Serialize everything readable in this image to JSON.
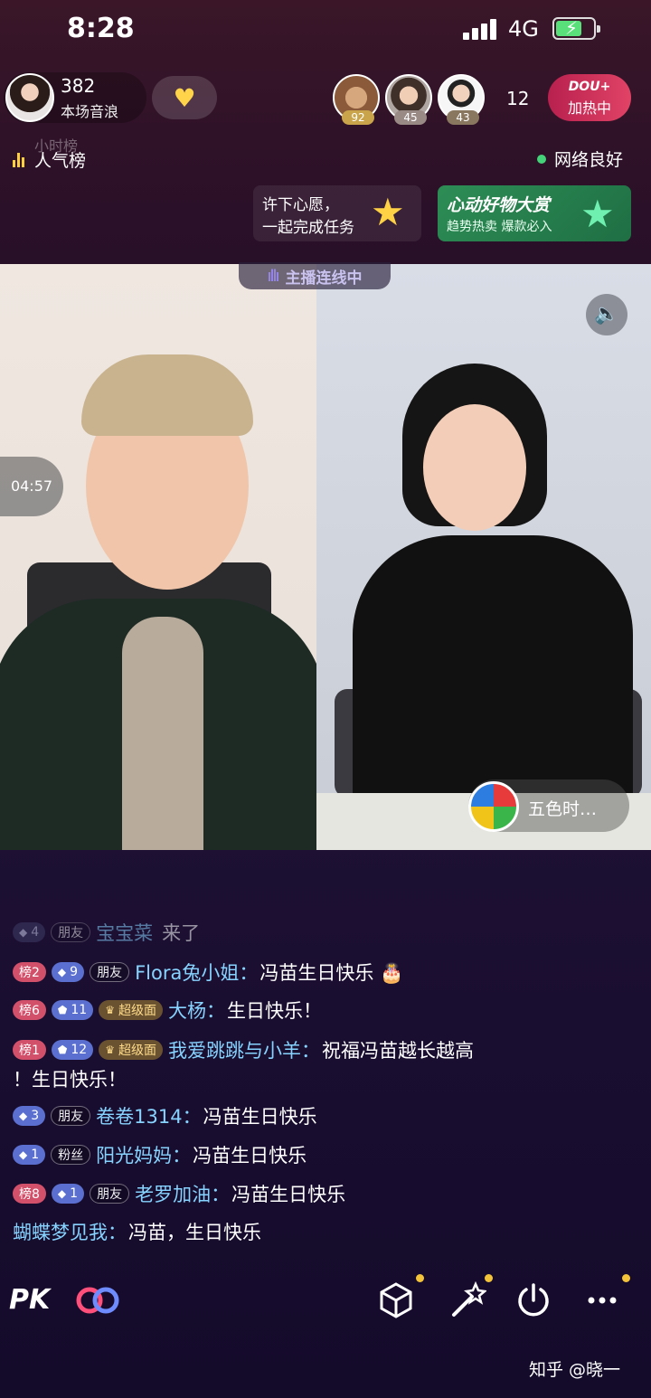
{
  "status_bar": {
    "time": "8:28",
    "network": "4G"
  },
  "host": {
    "count": "382",
    "label": "本场音浪"
  },
  "viewers": [
    "92",
    "45",
    "43"
  ],
  "viewer_count": "12",
  "dou": {
    "logo": "DOU+",
    "label": "加热中"
  },
  "rank": {
    "previous": "小时榜",
    "label": "人气榜"
  },
  "network_status": "网络良好",
  "wish_card": {
    "line1": "许下心愿，",
    "line2": "一起完成任务"
  },
  "goods_card": {
    "title": "心动好物大赏",
    "subtitle": "趋势热卖 爆款必入"
  },
  "link_tag": "主播连线中",
  "timer": "04:57",
  "guest_name": "五色时…",
  "comments": [
    {
      "fans": "4",
      "role": "朋友",
      "user": "宝宝菜",
      "text": "来了"
    },
    {
      "rank": "榜2",
      "fans": "9",
      "role": "朋友",
      "user": "Flora兔小姐：",
      "text": "冯苗生日快乐 🎂"
    },
    {
      "rank": "榜6",
      "fans": "11",
      "role": "超级面",
      "user": "大杨：",
      "text": "生日快乐！"
    },
    {
      "rank": "榜1",
      "fans": "12",
      "role": "超级面",
      "user": "我爱跳跳与小羊：",
      "text": "祝福冯苗越长越高",
      "text2": "！生日快乐！"
    },
    {
      "fans": "3",
      "role": "朋友",
      "user": "卷卷1314：",
      "text": "冯苗生日快乐"
    },
    {
      "fans": "1",
      "role": "粉丝",
      "user": "阳光妈妈：",
      "text": "冯苗生日快乐"
    },
    {
      "rank": "榜8",
      "fans": "1",
      "role": "朋友",
      "user": "老罗加油：",
      "text": "冯苗生日快乐"
    },
    {
      "user": "蝴蝶梦见我：",
      "text": "冯苗，生日快乐"
    }
  ],
  "bottom_bar": {
    "pk": "PK",
    "watermark": "知乎 @晓一"
  },
  "colors": {
    "accent": "#e14366",
    "username": "#87d3ff",
    "online": "#45d37a"
  }
}
